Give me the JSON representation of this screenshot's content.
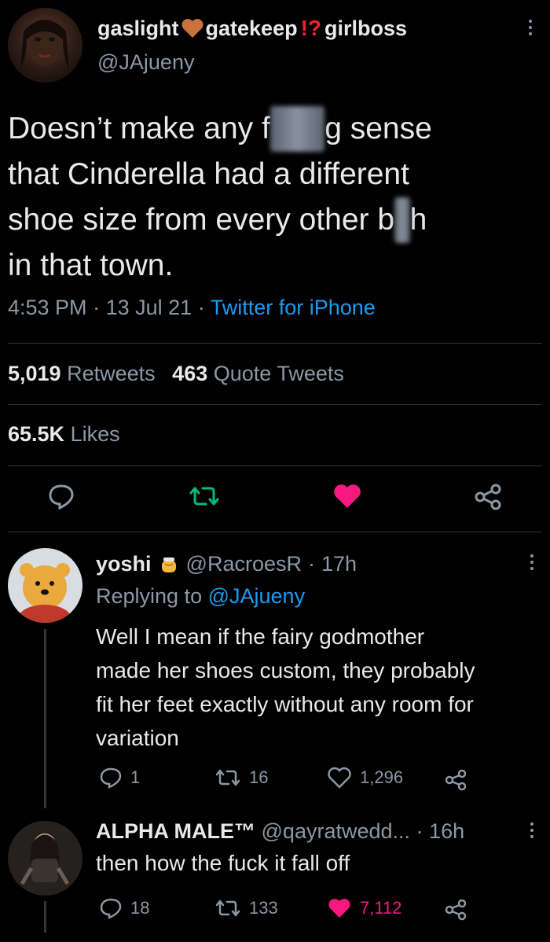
{
  "tweet": {
    "display_name_part1": "gaslight",
    "display_name_part2": "gatekeep",
    "display_name_part3": "girlboss",
    "handle": "@JAjueny",
    "text_line1_a": "Doesn’t make any f",
    "text_line1_blur": "ucki",
    "text_line1_b": "g sense",
    "text_line2": "that Cinderella had a different",
    "text_line3_a": "shoe size from every other b",
    "text_line3_blur": "it",
    "text_line3_b": "h",
    "text_line4": "in that town.",
    "time": "4:53 PM",
    "date": "13 Jul 21",
    "source": "Twitter for iPhone",
    "retweets_count": "5,019",
    "retweets_label": "Retweets",
    "quotes_count": "463",
    "quotes_label": "Quote Tweets",
    "likes_count": "65.5K",
    "likes_label": "Likes"
  },
  "reply1": {
    "name": "yoshi",
    "handle": "@RacroesR",
    "time": "17h",
    "replying_prefix": "Replying to",
    "replying_to": "@JAjueny",
    "text_line1": "Well I mean if the fairy godmother",
    "text_line2": "made her shoes custom, they probably",
    "text_line3": "fit her feet exactly without any room for",
    "text_line4": "variation",
    "replies": "1",
    "retweets": "16",
    "likes": "1,296"
  },
  "reply2": {
    "name": "ALPHA MALE™",
    "handle": "@qayratwedd...",
    "time": "16h",
    "text": "then how the fuck it fall off",
    "replies": "18",
    "retweets": "133",
    "likes": "7,112"
  },
  "colors": {
    "accent": "#1d9bf0",
    "like": "#f91880",
    "retweet": "#00ba7c",
    "muted": "#8b98a5"
  }
}
